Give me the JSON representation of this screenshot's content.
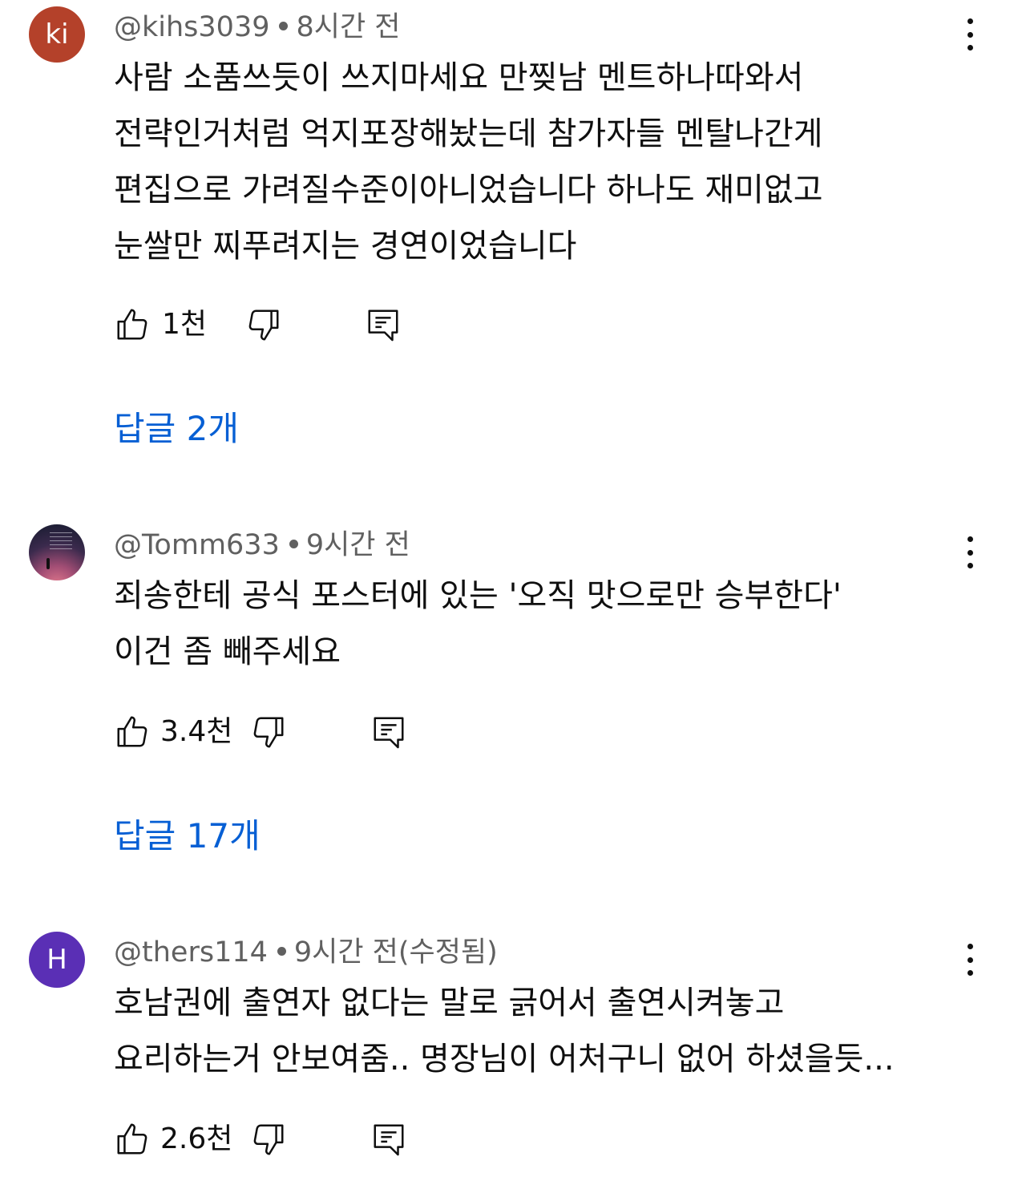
{
  "comments": [
    {
      "avatar": {
        "type": "letters",
        "text": "ki",
        "color": "#b4412a"
      },
      "handle": "@kihs3039",
      "time": "8시간 전",
      "lines": [
        "사람 소품쓰듯이 쓰지마세요 만찢남 멘트하나따와서",
        "전략인거처럼 억지포장해놨는데 참가자들 멘탈나간게",
        "편집으로 가려질수준이아니었습니다 하나도 재미없고",
        "눈쌀만 찌푸려지는 경연이었습니다"
      ],
      "likes": "1천",
      "replies": "답글 2개"
    },
    {
      "avatar": {
        "type": "image",
        "description": "sunset sky with small text and silhouette"
      },
      "handle": "@Tomm633",
      "time": "9시간 전",
      "lines": [
        "죄송한테 공식 포스터에 있는 '오직 맛으로만 승부한다'",
        "이건 좀 빼주세요"
      ],
      "likes": "3.4천",
      "replies": "답글 17개"
    },
    {
      "avatar": {
        "type": "letters",
        "text": "H",
        "color": "#5a2fb5"
      },
      "handle": "@thers114",
      "time": "9시간 전(수정됨)",
      "lines": [
        "호남권에 출연자 없다는 말로 긁어서 출연시켜놓고",
        "요리하는거 안보여줌.. 명장님이 어처구니 없어 하셨을듯..."
      ],
      "likes": "2.6천"
    }
  ],
  "colors": {
    "meta_text": "#606060",
    "replies_link": "#065fd4",
    "primary_text": "#0f0f0f"
  },
  "icons": {
    "like": "thumbs-up-outline-icon",
    "dislike": "thumbs-down-outline-icon",
    "reply": "comment-reply-icon",
    "more": "more-vertical-icon"
  }
}
